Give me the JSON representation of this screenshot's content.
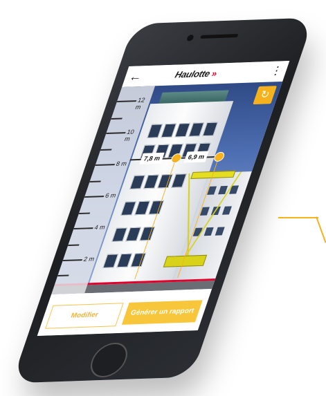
{
  "header": {
    "logo_text": "Haulotte",
    "logo_chevrons": "»"
  },
  "icons": {
    "back": "arrow-left-icon",
    "menu": "more-vertical-icon",
    "refresh": "refresh-icon"
  },
  "ruler": {
    "labels": [
      "12 m",
      "10 m",
      "8 m",
      "6 m",
      "4 m",
      "2 m"
    ]
  },
  "measurements": {
    "left": "7,8 m",
    "right": "6,9 m"
  },
  "buttons": {
    "modify": "Modifier",
    "generate": "Générer un rapport"
  },
  "colors": {
    "accent": "#f6b21d",
    "brand_red": "#e3002b"
  }
}
